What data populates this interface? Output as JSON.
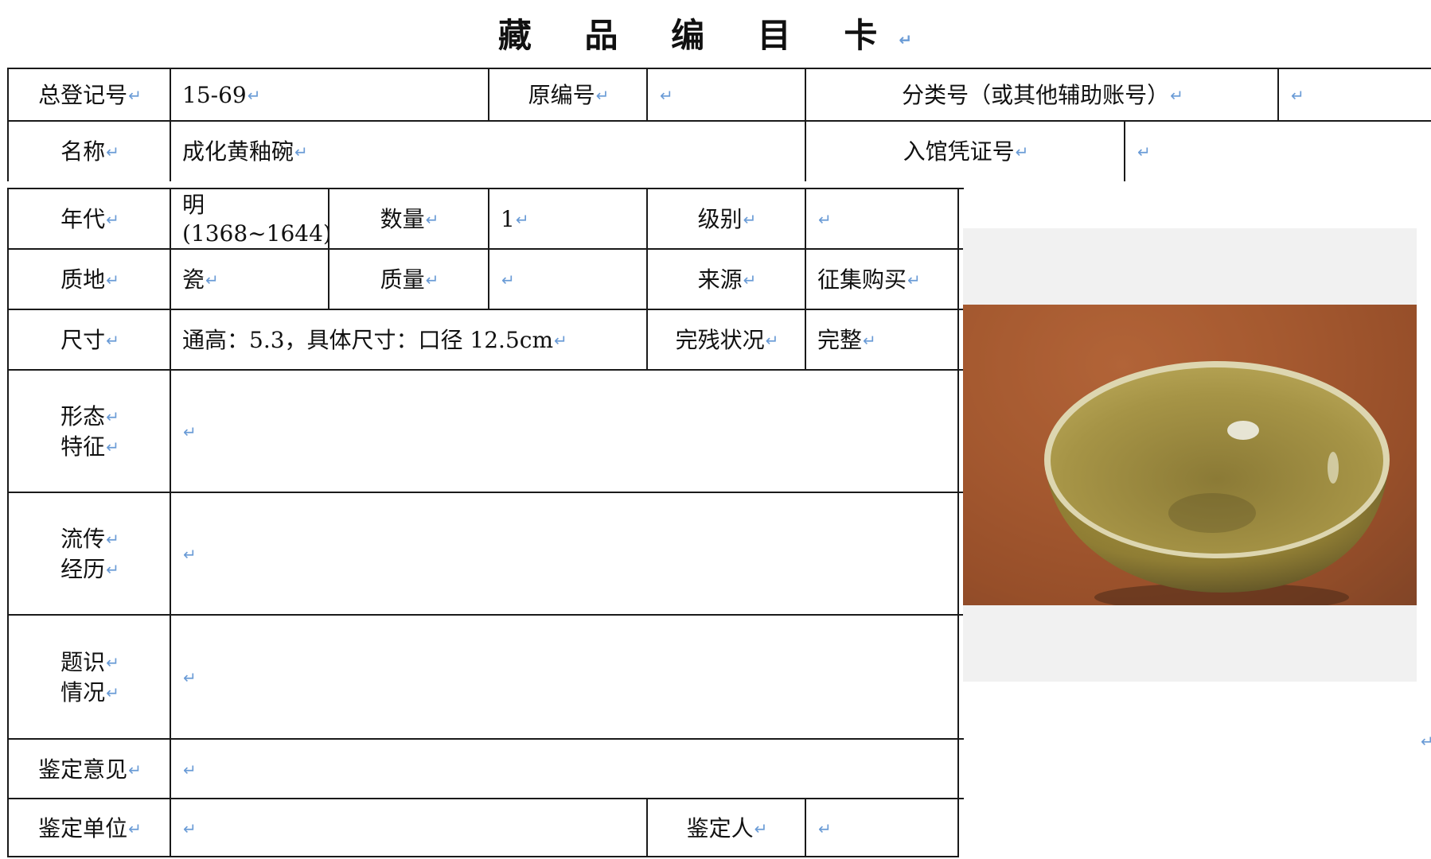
{
  "title": "藏 品 编 目 卡",
  "paragraph_mark": "↵",
  "card": {
    "total_reg_no": {
      "label": "总登记号",
      "value": "15-69"
    },
    "original_no": {
      "label": "原编号",
      "value": ""
    },
    "class_no": {
      "label": "分类号（或其他辅助账号）",
      "value": ""
    },
    "name": {
      "label": "名称",
      "value": "成化黄釉碗"
    },
    "entry_voucher": {
      "label": "入馆凭证号",
      "value": ""
    },
    "era": {
      "label": "年代",
      "value_line1": "明",
      "value_line2": "(1368~1644)"
    },
    "quantity": {
      "label": "数量",
      "value": "1"
    },
    "grade": {
      "label": "级别",
      "value": ""
    },
    "material": {
      "label": "质地",
      "value": "瓷"
    },
    "weight": {
      "label": "质量",
      "value": ""
    },
    "source": {
      "label": "来源",
      "value": "征集购买"
    },
    "size": {
      "label": "尺寸",
      "value": "通高：5.3，具体尺寸：口径 12.5cm"
    },
    "condition": {
      "label": "完残状况",
      "value": "完整"
    },
    "form": {
      "label_line1": "形态",
      "label_line2": "特征",
      "value": ""
    },
    "provenance": {
      "label_line1": "流传",
      "label_line2": "经历",
      "value": ""
    },
    "inscription": {
      "label_line1": "题识",
      "label_line2": "情况",
      "value": ""
    },
    "appraisal_opinion": {
      "label": "鉴定意见",
      "value": ""
    },
    "appraisal_unit": {
      "label": "鉴定单位",
      "value": ""
    },
    "appraiser": {
      "label": "鉴定人",
      "value": ""
    }
  },
  "photo": {
    "icon": "yellow-glazed-bowl-photo",
    "colors": {
      "tabletop": "#a65a30",
      "glaze": "#9c8a3c",
      "rim": "#ded8b4"
    }
  }
}
